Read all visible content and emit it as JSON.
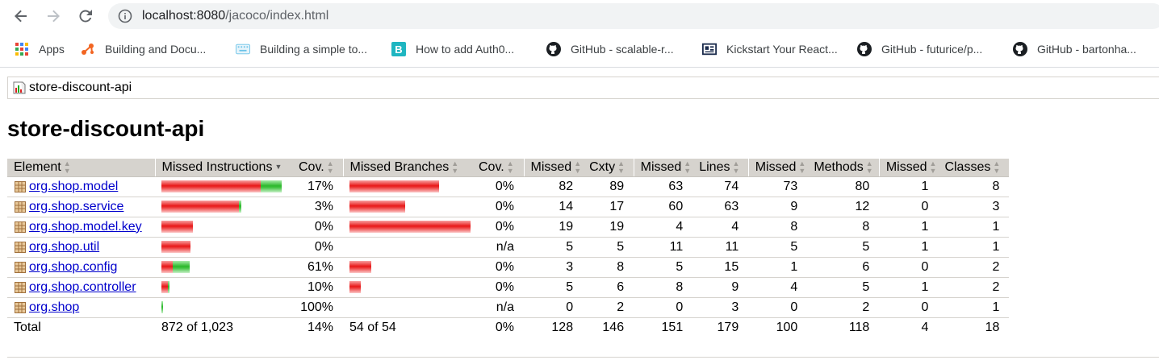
{
  "browser": {
    "url_host": "localhost:8080",
    "url_path": "/jacoco/index.html"
  },
  "bookmarks": [
    {
      "label": "Apps",
      "icon": "apps-grid-icon"
    },
    {
      "label": "Building and Docu...",
      "icon": "bookmark-favicon-icon"
    },
    {
      "label": "Building a simple to...",
      "icon": "keyboard-favicon-icon"
    },
    {
      "label": "How to add Auth0...",
      "icon": "b-favicon-icon"
    },
    {
      "label": "GitHub - scalable-r...",
      "icon": "github-icon"
    },
    {
      "label": "Kickstart Your React...",
      "icon": "card-favicon-icon"
    },
    {
      "label": "GitHub - futurice/p...",
      "icon": "github-icon"
    },
    {
      "label": "GitHub - bartonha...",
      "icon": "github-icon"
    }
  ],
  "breadcrumb": "store-discount-api",
  "page_title": "store-discount-api",
  "table": {
    "headers": [
      "Element",
      "Missed Instructions",
      "Cov.",
      "Missed Branches",
      "Cov.",
      "Missed",
      "Cxty",
      "Missed",
      "Lines",
      "Missed",
      "Methods",
      "Missed",
      "Classes"
    ],
    "rows": [
      {
        "element": "org.shop.model",
        "instr_missed_frac": 0.82,
        "instr_cov_frac": 0.17,
        "instr_cov": "17%",
        "branch_missed_frac": 0.74,
        "branch_cov_frac": 0,
        "branch_cov": "0%",
        "missed_cxty": "82",
        "cxty": "89",
        "missed_lines": "63",
        "lines": "74",
        "missed_methods": "73",
        "methods": "80",
        "missed_classes": "1",
        "classes": "8"
      },
      {
        "element": "org.shop.service",
        "instr_missed_frac": 0.64,
        "instr_cov_frac": 0.02,
        "instr_cov": "3%",
        "branch_missed_frac": 0.46,
        "branch_cov_frac": 0,
        "branch_cov": "0%",
        "missed_cxty": "14",
        "cxty": "17",
        "missed_lines": "60",
        "lines": "63",
        "missed_methods": "9",
        "methods": "12",
        "missed_classes": "0",
        "classes": "3"
      },
      {
        "element": "org.shop.model.key",
        "instr_missed_frac": 0.26,
        "instr_cov_frac": 0,
        "instr_cov": "0%",
        "branch_missed_frac": 1.0,
        "branch_cov_frac": 0,
        "branch_cov": "0%",
        "missed_cxty": "19",
        "cxty": "19",
        "missed_lines": "4",
        "lines": "4",
        "missed_methods": "8",
        "methods": "8",
        "missed_classes": "1",
        "classes": "1"
      },
      {
        "element": "org.shop.util",
        "instr_missed_frac": 0.24,
        "instr_cov_frac": 0,
        "instr_cov": "0%",
        "branch_missed_frac": 0,
        "branch_cov_frac": 0,
        "branch_cov": "n/a",
        "missed_cxty": "5",
        "cxty": "5",
        "missed_lines": "11",
        "lines": "11",
        "missed_methods": "5",
        "methods": "5",
        "missed_classes": "1",
        "classes": "1"
      },
      {
        "element": "org.shop.config",
        "instr_missed_frac": 0.09,
        "instr_cov_frac": 0.14,
        "instr_cov": "61%",
        "branch_missed_frac": 0.18,
        "branch_cov_frac": 0,
        "branch_cov": "0%",
        "missed_cxty": "3",
        "cxty": "8",
        "missed_lines": "5",
        "lines": "15",
        "missed_methods": "1",
        "methods": "6",
        "missed_classes": "0",
        "classes": "2"
      },
      {
        "element": "org.shop.controller",
        "instr_missed_frac": 0.05,
        "instr_cov_frac": 0.005,
        "instr_cov": "10%",
        "branch_missed_frac": 0.09,
        "branch_cov_frac": 0,
        "branch_cov": "0%",
        "missed_cxty": "5",
        "cxty": "6",
        "missed_lines": "8",
        "lines": "9",
        "missed_methods": "4",
        "methods": "5",
        "missed_classes": "1",
        "classes": "2"
      },
      {
        "element": "org.shop",
        "instr_missed_frac": 0,
        "instr_cov_frac": 0.012,
        "instr_cov": "100%",
        "branch_missed_frac": 0,
        "branch_cov_frac": 0,
        "branch_cov": "n/a",
        "missed_cxty": "0",
        "cxty": "2",
        "missed_lines": "0",
        "lines": "3",
        "missed_methods": "0",
        "methods": "2",
        "missed_classes": "0",
        "classes": "1"
      }
    ],
    "total": {
      "label": "Total",
      "instr": "872 of 1,023",
      "instr_cov": "14%",
      "branch": "54 of 54",
      "branch_cov": "0%",
      "missed_cxty": "128",
      "cxty": "146",
      "missed_lines": "151",
      "lines": "179",
      "missed_methods": "100",
      "methods": "118",
      "missed_classes": "4",
      "classes": "18"
    }
  },
  "colors": {
    "header_bg": "#d6d3ce",
    "link": "#0000cc",
    "bar_missed": "#e81818",
    "bar_covered": "#2cb82c"
  }
}
